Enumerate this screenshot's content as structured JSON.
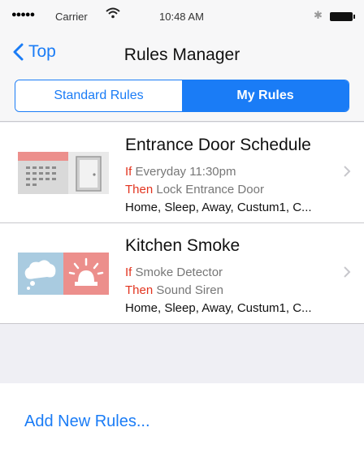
{
  "status_bar": {
    "signal": "●●●●●",
    "carrier": "Carrier",
    "time": "10:48 AM",
    "icons": [
      "wifi-icon",
      "bluetooth-icon",
      "battery-icon"
    ]
  },
  "nav": {
    "back_label": "Top",
    "title": "Rules Manager"
  },
  "segments": {
    "standard": "Standard Rules",
    "mine": "My Rules",
    "selected": "My Rules"
  },
  "rules": [
    {
      "title": "Entrance Door Schedule",
      "if_kw": "If",
      "if_text": "Everyday 11:30pm",
      "then_kw": "Then",
      "then_text": "Lock Entrance Door",
      "modes": "Home, Sleep, Away, Custum1, C...",
      "icon": "calendar-door-icon"
    },
    {
      "title": "Kitchen Smoke",
      "if_kw": "If",
      "if_text": "Smoke Detector",
      "then_kw": "Then",
      "then_text": "Sound Siren",
      "modes": "Home, Sleep, Away, Custum1, C...",
      "icon": "smoke-siren-icon"
    }
  ],
  "add_label": "Add New Rules...",
  "colors": {
    "accent": "#1a7cf6",
    "keyword": "#e2341f",
    "background": "#efeff4"
  }
}
